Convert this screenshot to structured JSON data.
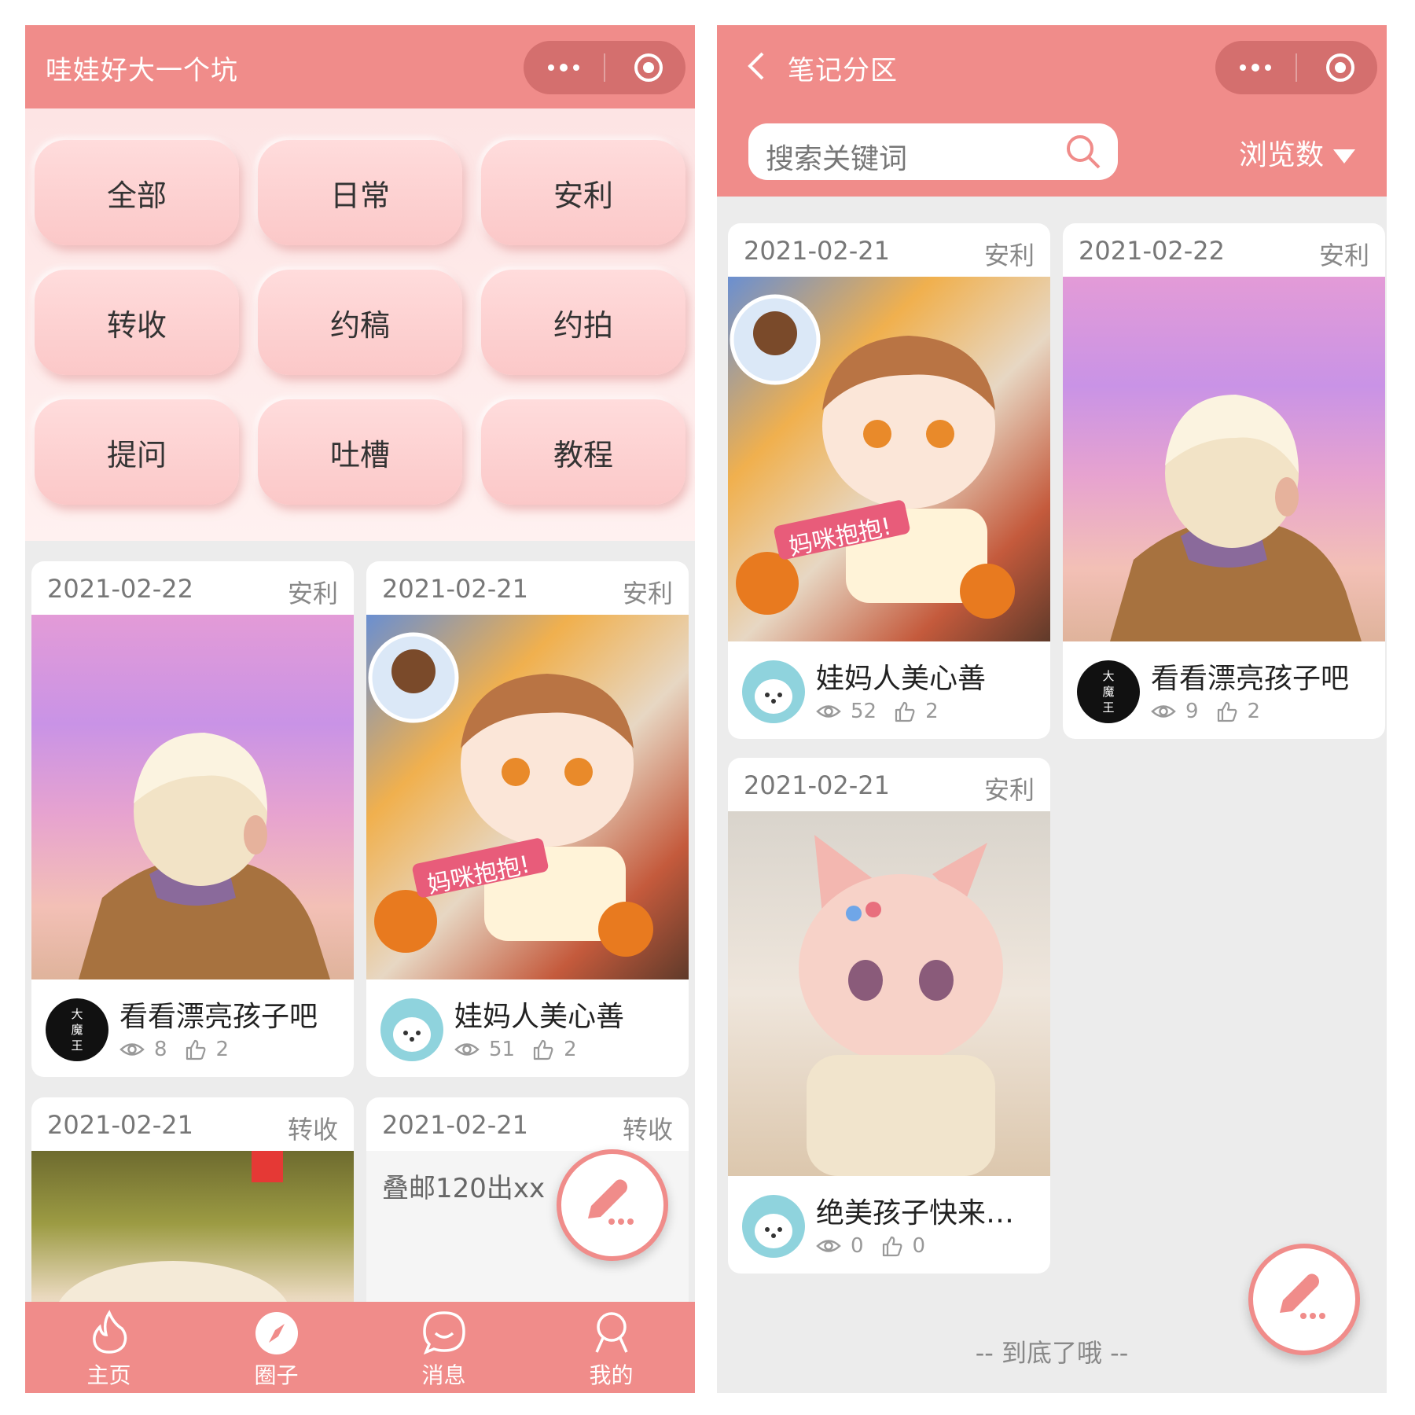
{
  "left_screen": {
    "title": "哇娃好大一个坑",
    "categories": [
      "全部",
      "日常",
      "安利",
      "转收",
      "约稿",
      "约拍",
      "提问",
      "吐槽",
      "教程"
    ],
    "cards": [
      {
        "date": "2021-02-22",
        "tag": "安利",
        "title": "看看漂亮孩子吧",
        "views": "8",
        "likes": "2",
        "avatar_text": "大魔王"
      },
      {
        "date": "2021-02-21",
        "tag": "安利",
        "title": "娃妈人美心善",
        "views": "51",
        "likes": "2",
        "image_caption": "妈咪抱抱!"
      },
      {
        "date": "2021-02-21",
        "tag": "转收"
      },
      {
        "date": "2021-02-21",
        "tag": "转收",
        "body": "叠邮120出xx"
      }
    ],
    "tabs": [
      {
        "label": "主页",
        "icon": "flame-icon"
      },
      {
        "label": "圈子",
        "icon": "compass-icon"
      },
      {
        "label": "消息",
        "icon": "chat-icon"
      },
      {
        "label": "我的",
        "icon": "user-icon"
      }
    ]
  },
  "right_screen": {
    "title": "笔记分区",
    "search_placeholder": "搜索关键词",
    "sort_label": "浏览数",
    "cards": [
      {
        "date": "2021-02-21",
        "tag": "安利",
        "title": "娃妈人美心善",
        "views": "52",
        "likes": "2",
        "image_caption": "妈咪抱抱!"
      },
      {
        "date": "2021-02-22",
        "tag": "安利",
        "title": "看看漂亮孩子吧",
        "views": "9",
        "likes": "2",
        "avatar_text": "大魔王"
      },
      {
        "date": "2021-02-21",
        "tag": "安利",
        "title": "绝美孩子快来…",
        "views": "0",
        "likes": "0"
      }
    ],
    "end_text": "-- 到底了哦 --"
  },
  "colors": {
    "primary": "#f08c8a",
    "capsule": "#d46f6e",
    "category_bg": "#fbc8c8",
    "page_bg": "#ececec"
  }
}
